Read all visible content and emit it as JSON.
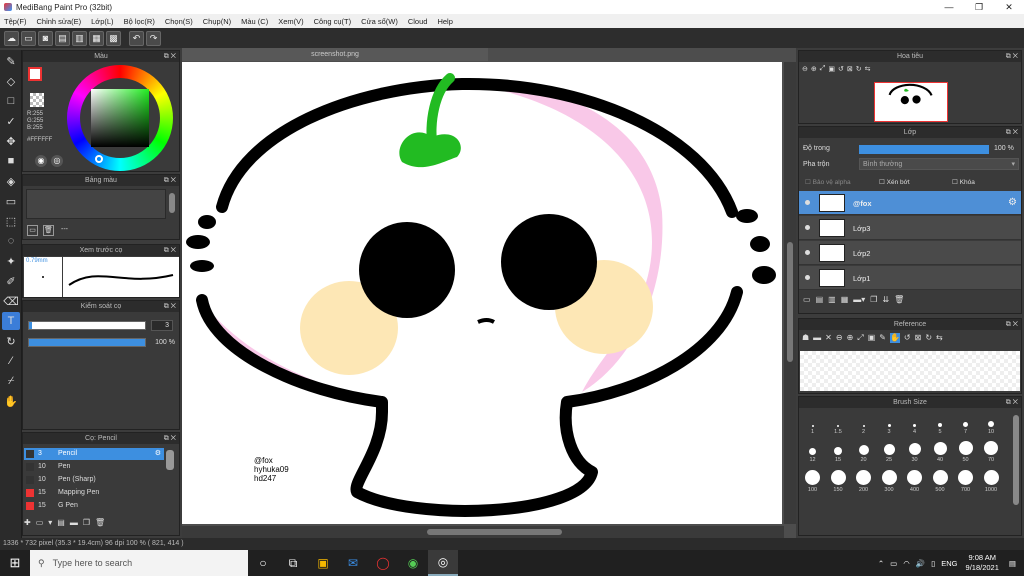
{
  "window": {
    "title": "MediBang Paint Pro (32bit)",
    "minimize": "—",
    "maximize": "❐",
    "close": "✕"
  },
  "menu": [
    "Tệp(F)",
    "Chỉnh sửa(E)",
    "Lớp(L)",
    "Bộ lọc(R)",
    "Chọn(S)",
    "Chụp(N)",
    "Màu (C)",
    "Xem(V)",
    "Công cụ(T)",
    "Cửa sổ(W)",
    "Cloud",
    "Help"
  ],
  "toolbar": {
    "undo": "↶",
    "redo": "↷"
  },
  "color_panel": {
    "title": "Màu",
    "r": "R:255",
    "g": "G:255",
    "b": "B:255",
    "hex": "#FFFFFF"
  },
  "palette_panel": {
    "title": "Bảng màu",
    "more": "---"
  },
  "brush_preview": {
    "title": "Xem trước cọ",
    "size": "0.79mm"
  },
  "brush_control": {
    "title": "Kiểm soát cọ",
    "size_value": "3",
    "opacity_value": "100 %",
    "opacity": 1.0
  },
  "brush_list": {
    "title": "Cọ: Pencil",
    "items": [
      {
        "size": "3",
        "name": "Pencil",
        "selected": true
      },
      {
        "size": "10",
        "name": "Pen"
      },
      {
        "size": "10",
        "name": "Pen (Sharp)"
      },
      {
        "size": "15",
        "name": "Mapping Pen"
      },
      {
        "size": "15",
        "name": "G Pen"
      }
    ]
  },
  "document": {
    "tab": "screenshot.png",
    "signature": [
      "@fox",
      "hyhuka09",
      "hd247"
    ]
  },
  "navigator": {
    "title": "Hoa tiêu"
  },
  "layer_panel": {
    "title": "Lớp",
    "opacity_label": "Độ trong",
    "opacity_value": "100 %",
    "opacity": 1.0,
    "blend_label": "Pha trộn",
    "blend_value": "Bình thường",
    "protect_alpha": "Bảo vệ alpha",
    "clipping": "Xén bớt",
    "lock": "Khóa",
    "layers": [
      {
        "name": "@fox",
        "selected": true
      },
      {
        "name": "Lớp3"
      },
      {
        "name": "Lớp2"
      },
      {
        "name": "Lớp1"
      }
    ]
  },
  "reference_panel": {
    "title": "Reference"
  },
  "brush_size_panel": {
    "title": "Brush Size",
    "sizes": [
      "1",
      "1.5",
      "2",
      "3",
      "4",
      "5",
      "7",
      "10",
      "12",
      "15",
      "20",
      "25",
      "30",
      "40",
      "50",
      "70",
      "100",
      "150",
      "200",
      "300",
      "400",
      "500",
      "700",
      "1000"
    ]
  },
  "status": {
    "text": "1336 * 732 pixel  (35.3 * 19.4cm)  96 dpi  100 %  ( 821, 414 )"
  },
  "taskbar": {
    "search_placeholder": "Type here to search",
    "lang": "ENG",
    "time": "9:08 AM",
    "date": "9/18/2021"
  },
  "colors": {
    "accent": "#3d8fe0",
    "selection": "#4e8fd6",
    "panel_bg": "#3a3a3a"
  }
}
